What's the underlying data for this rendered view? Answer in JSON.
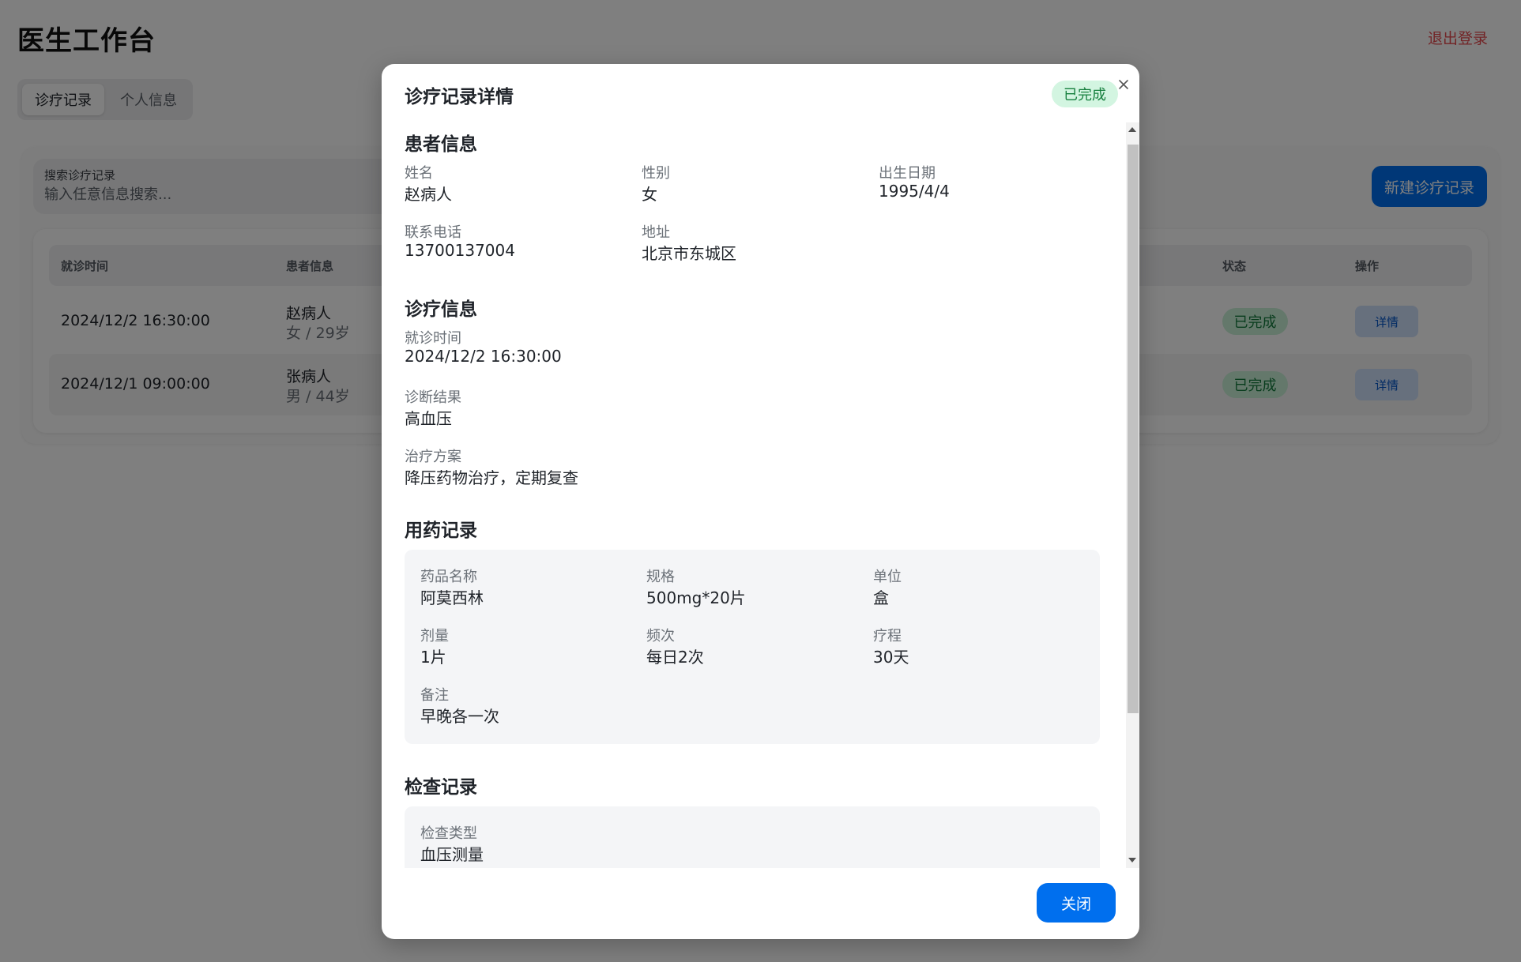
{
  "app": {
    "title": "医生工作台",
    "logout_label": "退出登录"
  },
  "tabs": [
    {
      "label": "诊疗记录",
      "active": true
    },
    {
      "label": "个人信息",
      "active": false
    }
  ],
  "search": {
    "label": "搜索诊疗记录",
    "placeholder": "输入任意信息搜索..."
  },
  "new_record_label": "新建诊疗记录",
  "table": {
    "headers": {
      "time": "就诊时间",
      "patient": "患者信息",
      "status": "状态",
      "action": "操作"
    },
    "rows": [
      {
        "time": "2024/12/2 16:30:00",
        "name": "赵病人",
        "sub": "女 / 29岁",
        "status": "已完成",
        "action": "详情"
      },
      {
        "time": "2024/12/1 09:00:00",
        "name": "张病人",
        "sub": "男 / 44岁",
        "status": "已完成",
        "action": "详情"
      }
    ]
  },
  "modal": {
    "title": "诊疗记录详情",
    "status_badge": "已完成",
    "close_button": "关闭",
    "patient": {
      "section_title": "患者信息",
      "name_label": "姓名",
      "name": "赵病人",
      "gender_label": "性别",
      "gender": "女",
      "dob_label": "出生日期",
      "dob": "1995/4/4",
      "phone_label": "联系电话",
      "phone": "13700137004",
      "address_label": "地址",
      "address": "北京市东城区"
    },
    "diagnosis": {
      "section_title": "诊疗信息",
      "time_label": "就诊时间",
      "time": "2024/12/2 16:30:00",
      "result_label": "诊断结果",
      "result": "高血压",
      "plan_label": "治疗方案",
      "plan": "降压药物治疗，定期复查"
    },
    "medication": {
      "section_title": "用药记录",
      "drug_label": "药品名称",
      "drug": "阿莫西林",
      "spec_label": "规格",
      "spec": "500mg*20片",
      "unit_label": "单位",
      "unit": "盒",
      "dose_label": "剂量",
      "dose": "1片",
      "freq_label": "频次",
      "freq": "每日2次",
      "course_label": "疗程",
      "course": "30天",
      "note_label": "备注",
      "note": "早晚各一次"
    },
    "exam": {
      "section_title": "检查记录",
      "type_label": "检查类型",
      "type": "血压测量"
    }
  }
}
